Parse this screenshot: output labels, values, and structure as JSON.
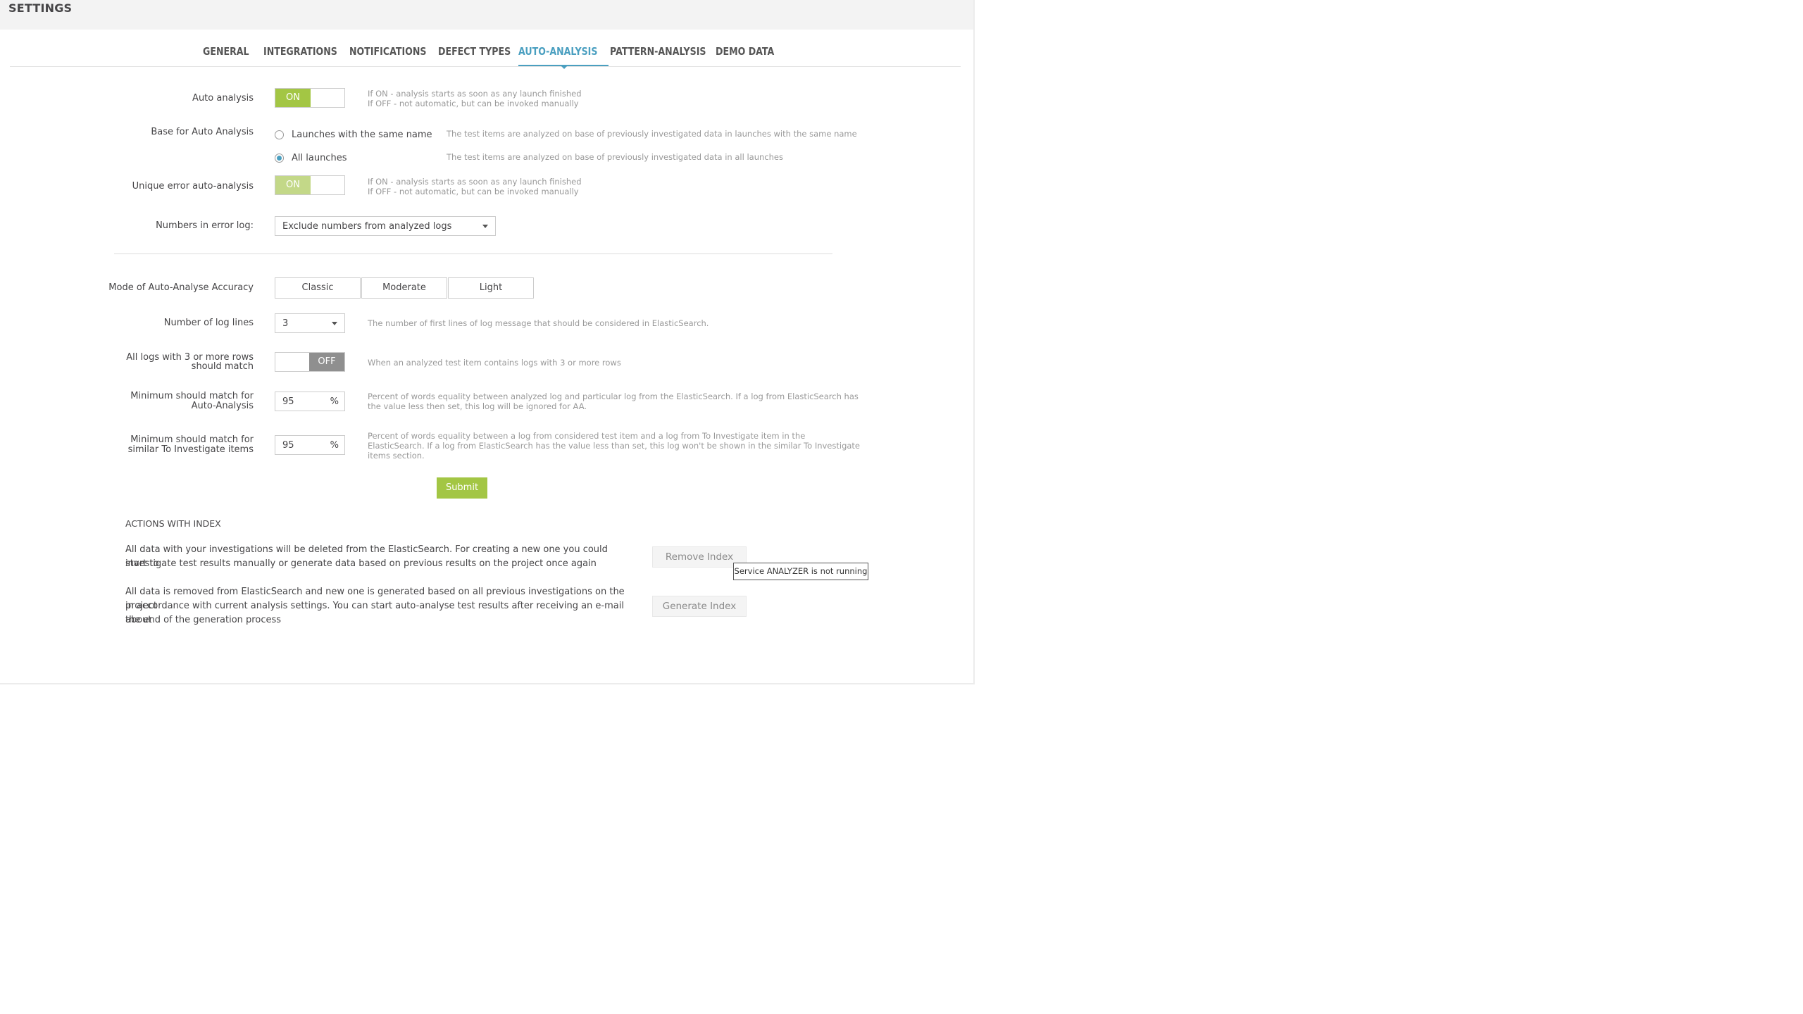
{
  "header": {
    "title": "SETTINGS"
  },
  "tabs": [
    {
      "label": "GENERAL"
    },
    {
      "label": "INTEGRATIONS"
    },
    {
      "label": "NOTIFICATIONS"
    },
    {
      "label": "DEFECT TYPES"
    },
    {
      "label": "AUTO-ANALYSIS"
    },
    {
      "label": "PATTERN-ANALYSIS"
    },
    {
      "label": "DEMO DATA"
    }
  ],
  "form": {
    "auto_analysis": {
      "label": "Auto analysis",
      "toggle": "ON",
      "hint1": "If ON - analysis starts as soon as any launch finished",
      "hint2": "If OFF - not automatic, but can be invoked manually"
    },
    "base": {
      "label": "Base for Auto Analysis",
      "option1": "Launches with the same name",
      "hint1": "The test items are analyzed on base of previously investigated data in launches with the same name",
      "option2": "All launches",
      "hint2": "The test items are analyzed on base of previously investigated data in all launches"
    },
    "unique_error": {
      "label": "Unique error auto-analysis",
      "toggle": "ON",
      "hint1": "If ON - analysis starts as soon as any launch finished",
      "hint2": "If OFF - not automatic, but can be invoked manually"
    },
    "numbers_log": {
      "label": "Numbers in error log:",
      "value": "Exclude numbers from analyzed logs"
    },
    "mode": {
      "label": "Mode of Auto-Analyse Accuracy",
      "options": [
        "Classic",
        "Moderate",
        "Light"
      ]
    },
    "log_lines": {
      "label": "Number of log lines",
      "value": "3",
      "hint": "The number of first lines of log message that should be considered in ElasticSearch."
    },
    "all_logs": {
      "label1": "All logs with 3 or more rows",
      "label2": "should match",
      "toggle": "OFF",
      "hint": "When an analyzed test item contains logs with 3 or more rows"
    },
    "min_match_aa": {
      "label1": "Minimum should match for",
      "label2": "Auto-Analysis",
      "value": "95",
      "unit": "%",
      "hint1": "Percent of words equality between analyzed log and particular log from the ElasticSearch. If a log from ElasticSearch has",
      "hint2": "the value less then set, this log will be ignored for AA."
    },
    "min_match_ti": {
      "label1": "Minimum should match for",
      "label2": "similar To Investigate items",
      "value": "95",
      "unit": "%",
      "hint1": "Percent of words equality between a log from considered test item and a log from To Investigate item in the",
      "hint2": "ElasticSearch. If a log from ElasticSearch has the value less than set, this log won't be shown in the similar To Investigate",
      "hint3": "items section."
    },
    "submit": "Submit"
  },
  "index": {
    "title": "ACTIONS WITH INDEX",
    "remove_text1": "All data with your investigations will be deleted from the ElasticSearch. For creating a new one you could start to",
    "remove_text2": "investigate test results manually or generate data based on previous results on the project once again",
    "remove_button": "Remove Index",
    "tooltip": "Service ANALYZER is not running",
    "generate_text1": "All data is removed from ElasticSearch and new one is generated based on all previous investigations on the project",
    "generate_text2": "in accordance with current analysis settings. You can start auto-analyse test results after receiving an e-mail about",
    "generate_text3": "the end of the generation process",
    "generate_button": "Generate Index"
  },
  "colors": {
    "accent_green": "#a3c644",
    "accent_blue": "#4a9fc0",
    "toggle_off_grey": "#8f8f8f"
  }
}
